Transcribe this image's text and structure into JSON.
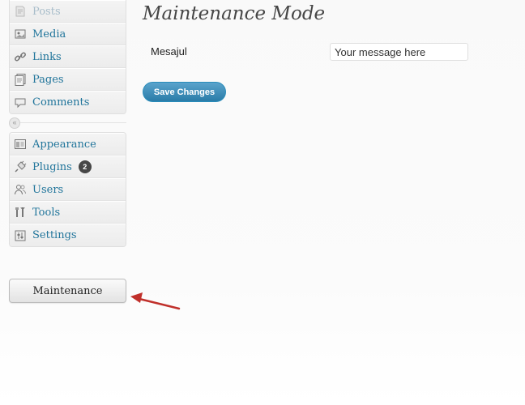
{
  "sidebar": {
    "group1": [
      {
        "label": "Posts",
        "icon": "posts-icon"
      },
      {
        "label": "Media",
        "icon": "media-icon"
      },
      {
        "label": "Links",
        "icon": "links-icon"
      },
      {
        "label": "Pages",
        "icon": "pages-icon"
      },
      {
        "label": "Comments",
        "icon": "comments-icon"
      }
    ],
    "collapse_glyph": "«",
    "group2": [
      {
        "label": "Appearance",
        "icon": "appearance-icon"
      },
      {
        "label": "Plugins",
        "icon": "plugins-icon",
        "badge": "2"
      },
      {
        "label": "Users",
        "icon": "users-icon"
      },
      {
        "label": "Tools",
        "icon": "tools-icon"
      },
      {
        "label": "Settings",
        "icon": "settings-icon"
      }
    ],
    "maintenance_label": "Maintenance"
  },
  "main": {
    "title": "Maintenance Mode",
    "field_label": "Mesajul",
    "field_value": "Your message here",
    "save_label": "Save Changes"
  },
  "colors": {
    "link": "#21759b",
    "primary_button": "#2a7ca8",
    "annotation_arrow": "#c0302b"
  }
}
